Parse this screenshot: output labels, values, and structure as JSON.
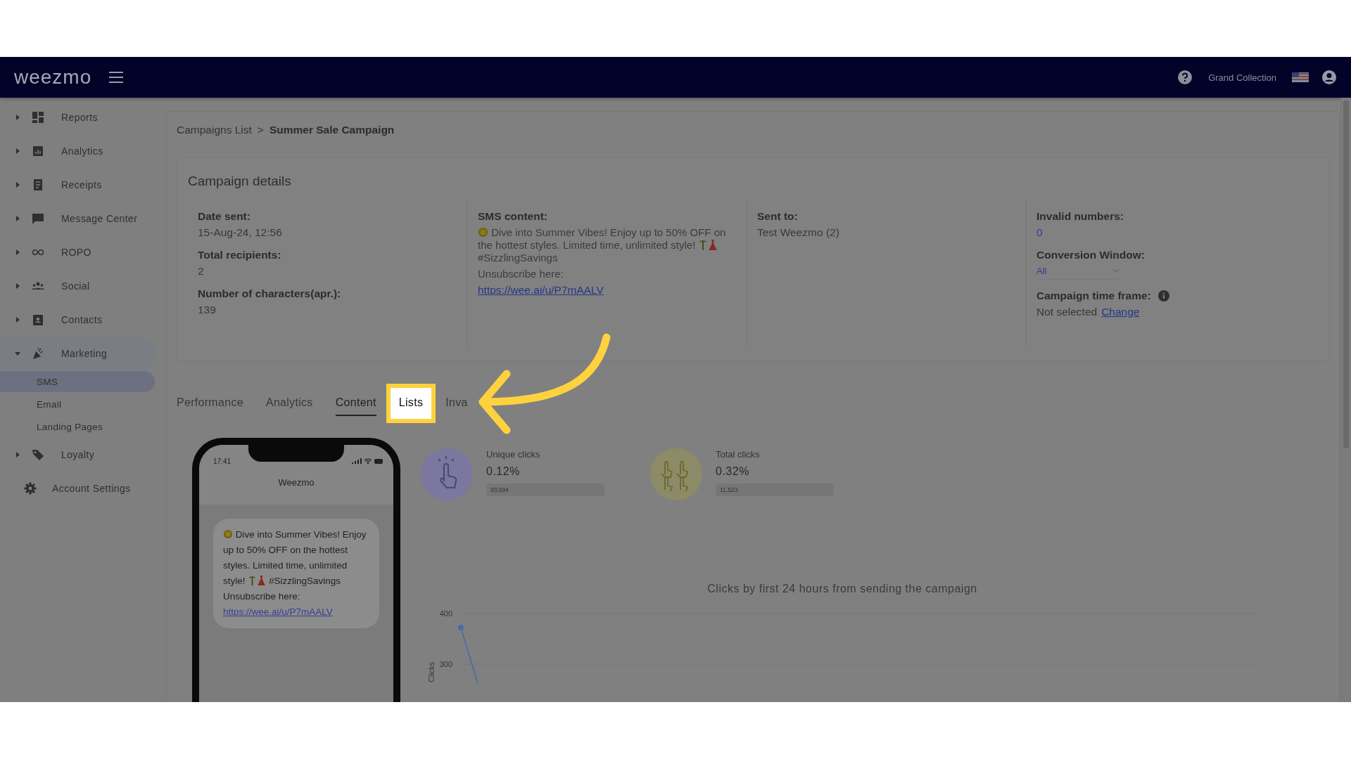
{
  "header": {
    "logo": "weezmo",
    "account": "Grand Collection"
  },
  "sidebar": {
    "items": [
      {
        "label": "Reports",
        "kind": "menu",
        "expanded": false
      },
      {
        "label": "Analytics",
        "kind": "menu",
        "expanded": false
      },
      {
        "label": "Receipts",
        "kind": "menu",
        "expanded": false
      },
      {
        "label": "Message Center",
        "kind": "menu",
        "expanded": false
      },
      {
        "label": "ROPO",
        "kind": "menu",
        "expanded": false
      },
      {
        "label": "Social",
        "kind": "menu",
        "expanded": false
      },
      {
        "label": "Contacts",
        "kind": "menu",
        "expanded": false
      },
      {
        "label": "Marketing",
        "kind": "menu",
        "expanded": true,
        "children": [
          {
            "label": "SMS",
            "selected": true
          },
          {
            "label": "Email",
            "selected": false
          },
          {
            "label": "Landing Pages",
            "selected": false
          }
        ]
      },
      {
        "label": "Loyalty",
        "kind": "menu",
        "expanded": false
      },
      {
        "label": "Account Settings",
        "kind": "link"
      }
    ]
  },
  "breadcrumb": {
    "parent": "Campaigns List",
    "separator": ">",
    "current": "Summer Sale Campaign"
  },
  "details": {
    "title": "Campaign details",
    "date_label": "Date sent:",
    "date": "15-Aug-24, 12:56",
    "recipients_label": "Total recipients:",
    "recipients": "2",
    "chars_label": "Number of characters(apr.):",
    "chars": "139",
    "sms_label": "SMS content:",
    "sms_text": "Dive into Summer Vibes! Enjoy up to 50% OFF on the hottest styles. Limited time, unlimited style!",
    "sms_hashtag": "#SizzlingSavings",
    "sms_unsubscribe": "Unsubscribe here:",
    "sms_link": "https://wee.ai/u/P7mAALV",
    "sent_to_label": "Sent to:",
    "sent_to": "Test Weezmo (2)",
    "invalid_label": "Invalid numbers:",
    "invalid": "0",
    "conversion_label": "Conversion Window:",
    "conversion": "All",
    "timeframe_label": "Campaign time frame:",
    "timeframe": "Not selected",
    "timeframe_link": "Change"
  },
  "tabs": [
    {
      "label": "Performance",
      "selected": false,
      "highlighted": false
    },
    {
      "label": "Analytics",
      "selected": false,
      "highlighted": false
    },
    {
      "label": "Content",
      "selected": true,
      "highlighted": false
    },
    {
      "label": "Lists",
      "selected": false,
      "highlighted": true
    },
    {
      "label": "Inva",
      "selected": false,
      "highlighted": false
    }
  ],
  "phone": {
    "time": "17:41",
    "sender": "Weezmo",
    "message": "Dive into Summer Vibes! Enjoy up to 50% OFF on the hottest styles. Limited time, unlimited style!",
    "hashtag": "#SizzlingSavings",
    "unsubscribe": "Unsubscribe here:",
    "link": "https://wee.ai/u/P7mAALV"
  },
  "stats": [
    {
      "label": "Unique clicks",
      "value": "0.12%",
      "count": "20,694",
      "color": "#7b779e"
    },
    {
      "label": "Total clicks",
      "value": "0.32%",
      "count": "11,523",
      "color": "#8d8b67"
    }
  ],
  "chart": {
    "title": "Clicks by first 24 hours from sending the campaign",
    "ylabel": "Clicks",
    "y_ticks": [
      "400",
      "300"
    ]
  }
}
